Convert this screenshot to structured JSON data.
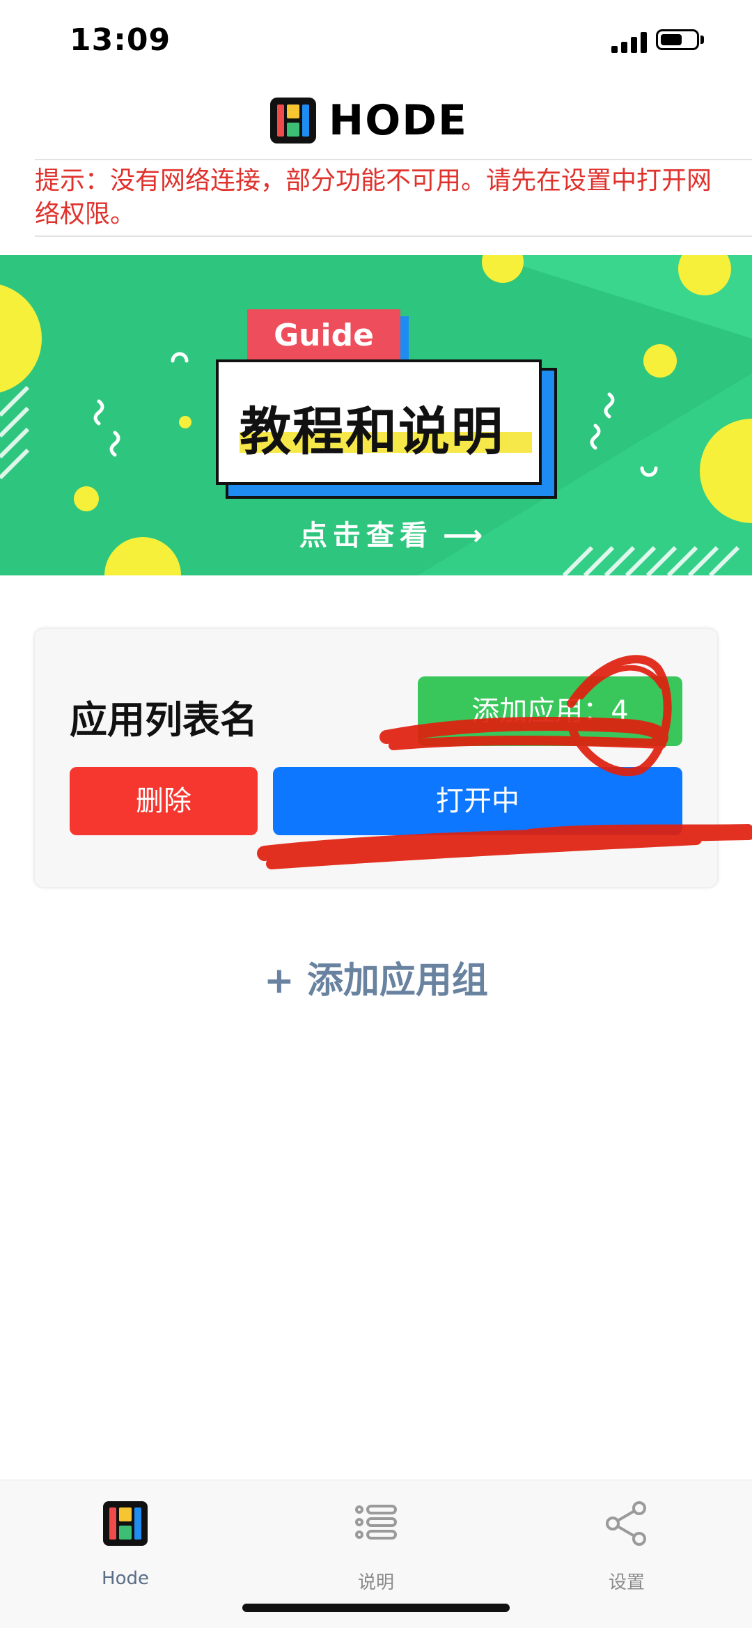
{
  "status_bar": {
    "time": "13:09"
  },
  "header": {
    "title": "HODE"
  },
  "network_warning": "提示：没有网络连接，部分功能不可用。请先在设置中打开网络权限。",
  "banner": {
    "tag": "Guide",
    "title": "教程和说明",
    "cta": "点击查看",
    "colors": {
      "background": "#33cf86",
      "accent_yellow": "#f7f03a",
      "tag_red": "#ee4d5c",
      "shadow_blue": "#1e8cf0"
    }
  },
  "app_group": {
    "name": "应用列表名",
    "add_app_label": "添加应用：4",
    "delete_label": "删除",
    "open_label": "打开中"
  },
  "add_group_label": "+ 添加应用组",
  "tab_bar": {
    "tabs": [
      {
        "label": "Hode",
        "icon": "hode-logo-icon",
        "active": true
      },
      {
        "label": "说明",
        "icon": "list-icon",
        "active": false
      },
      {
        "label": "设置",
        "icon": "share-icon",
        "active": false
      }
    ]
  },
  "colors": {
    "warning_red": "#e0322d",
    "add_green": "#39c75c",
    "delete_red": "#f6372f",
    "open_blue": "#0d78ff",
    "scribble_red": "#e0200e"
  }
}
